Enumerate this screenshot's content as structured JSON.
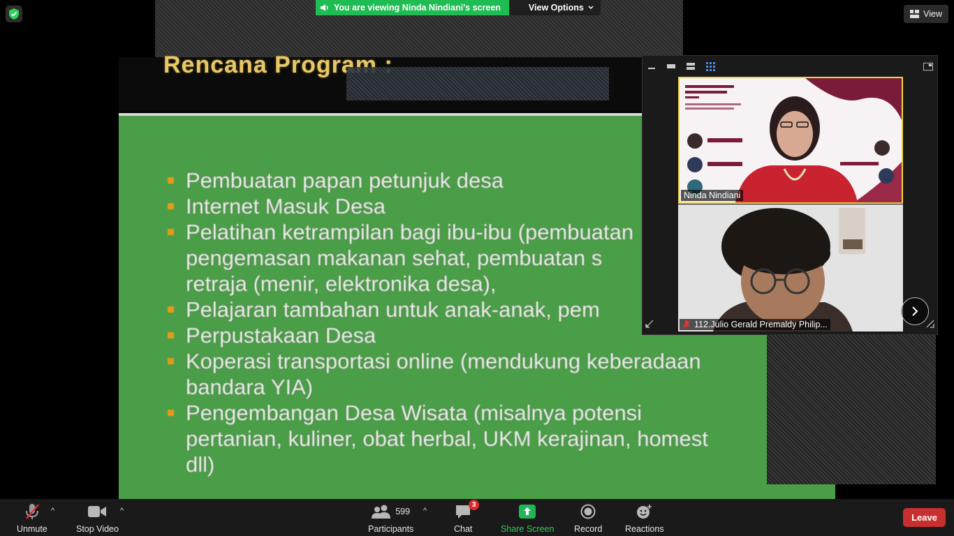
{
  "banner": {
    "viewing_text": "You are viewing Ninda Nindiani's screen",
    "view_options": "View Options"
  },
  "view_button": "View",
  "slide": {
    "title": "Rencana Program :",
    "bullets": [
      "Pembuatan papan petunjuk desa",
      "Internet Masuk Desa",
      "Pelatihan ketrampilan bagi ibu-ibu (pembuatan\npengemasan makanan sehat, pembuatan s\nretraja (menir, elektronika desa),",
      "Pelajaran tambahan untuk anak-anak, pem",
      "Perpustakaan Desa",
      "Koperasi transportasi online (mendukung keberadaan\nbandara YIA)",
      "Pengembangan Desa Wisata (misalnya potensi\npertanian, kuliner, obat herbal, UKM kerajinan, homest\ndll)"
    ]
  },
  "gallery": {
    "participants": [
      {
        "name": "Ninda Nindiani",
        "muted": false,
        "active_speaker": true
      },
      {
        "name": "112.Julio Gerald Premaldy Philip...",
        "muted": true,
        "active_speaker": false
      }
    ]
  },
  "toolbar": {
    "unmute": "Unmute",
    "stop_video": "Stop Video",
    "participants": "Participants",
    "participants_count": "599",
    "chat": "Chat",
    "chat_badge": "3",
    "share_screen": "Share Screen",
    "record": "Record",
    "reactions": "Reactions",
    "leave": "Leave"
  },
  "colors": {
    "active_speaker_border": "#f0d53e",
    "share_green": "#34c759",
    "leave_red": "#c8302f",
    "slide_green": "#4a9e47"
  }
}
